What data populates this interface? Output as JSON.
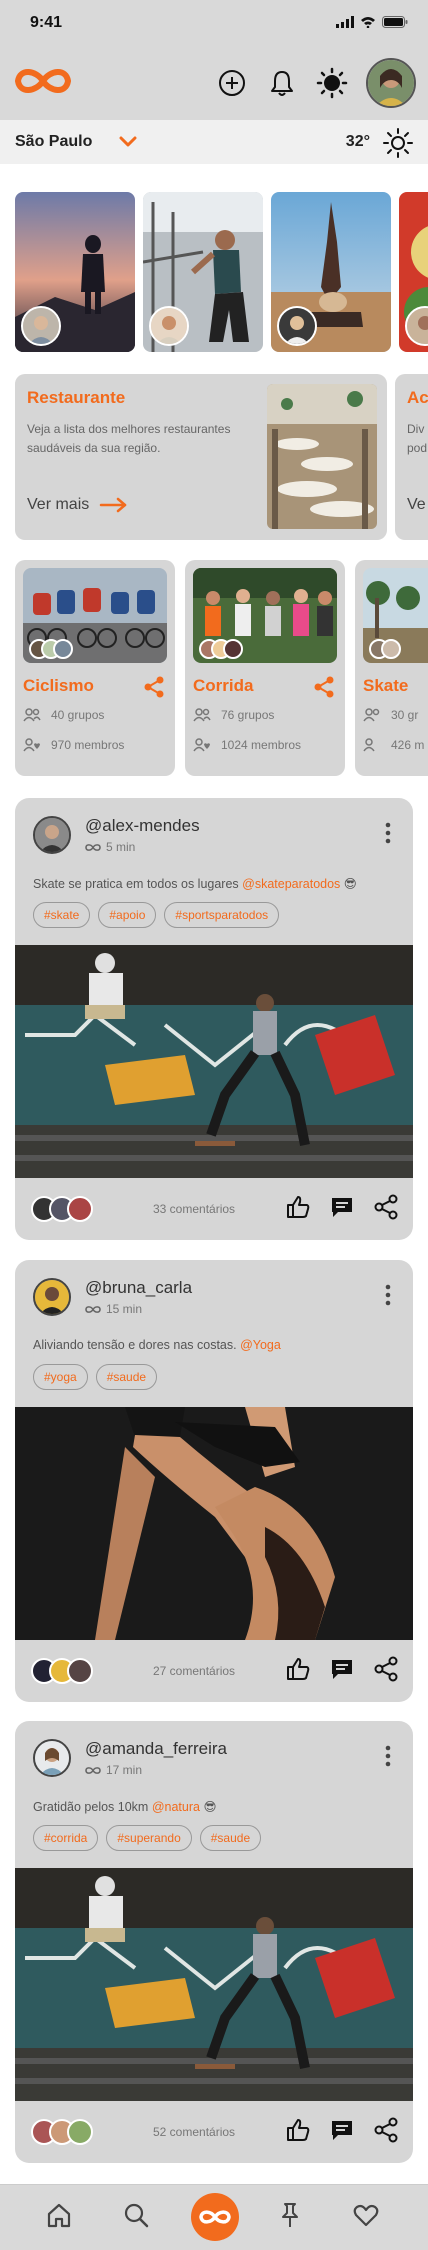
{
  "status_bar": {
    "time": "9:41"
  },
  "header": {
    "logo_icon": "infinity-logo-icon",
    "accent": "#f26b1d"
  },
  "location": {
    "city": "São Paulo",
    "temperature": "32°"
  },
  "promos": [
    {
      "title": "Restaurante",
      "description": "Veja a lista dos melhores restaurantes saudáveis da sua região.",
      "link": "Ver mais"
    },
    {
      "title": "Ac",
      "description": "Div pod",
      "link": "Ve"
    }
  ],
  "groups": [
    {
      "title": "Ciclismo",
      "groups_count": "40 grupos",
      "members": "970 membros"
    },
    {
      "title": "Corrida",
      "groups_count": "76 grupos",
      "members": "1024 membros"
    },
    {
      "title": "Skate",
      "groups_count": "30 gr",
      "members": "426 m"
    }
  ],
  "posts": [
    {
      "user": "@alex-mendes",
      "time": "5 min",
      "text": "Skate se pratica em todos os lugares ",
      "mention": "@skateparatodos",
      "emoji": "😎",
      "tags": [
        "#skate",
        "#apoio",
        "#sportsparatodos"
      ],
      "comments": "33 comentários"
    },
    {
      "user": "@bruna_carla",
      "time": "15 min",
      "text": "Aliviando tensão e dores nas costas. ",
      "mention": "@Yoga",
      "emoji": "",
      "tags": [
        "#yoga",
        "#saude"
      ],
      "comments": "27 comentários"
    },
    {
      "user": "@amanda_ferreira",
      "time": "17 min",
      "text": "Gratidão pelos 10km ",
      "mention": "@natura",
      "emoji": "😎",
      "tags": [
        "#corrida",
        "#superando",
        "#saude"
      ],
      "comments": "52 comentários"
    }
  ]
}
